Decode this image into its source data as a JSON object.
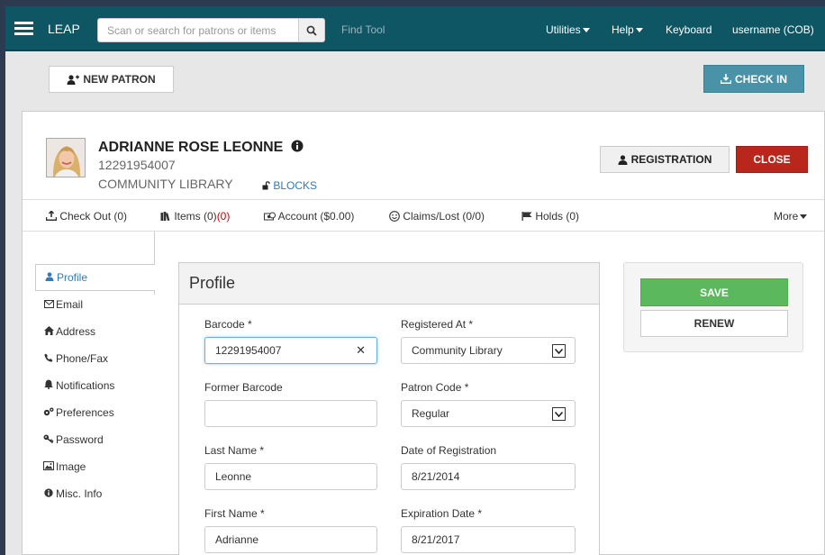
{
  "nav": {
    "brand": "LEAP",
    "search_placeholder": "Scan or search for patrons or items",
    "find_tool": "Find Tool",
    "utilities": "Utilities",
    "help": "Help",
    "keyboard": "Keyboard",
    "user": "username  (COB)"
  },
  "actions": {
    "new_patron": "NEW PATRON",
    "check_in": "CHECK IN"
  },
  "patron": {
    "name": "ADRIANNE ROSE LEONNE",
    "barcode": "12291954007",
    "library": "COMMUNITY LIBRARY",
    "blocks": "BLOCKS",
    "registration_btn": "REGISTRATION",
    "close_btn": "CLOSE"
  },
  "tabs": {
    "checkout": "Check Out (0)",
    "items": "Items (0)",
    "items_extra": "(0)",
    "account": "Account ($0.00)",
    "claims": "Claims/Lost (0/0)",
    "holds": "Holds (0)",
    "more": "More"
  },
  "sidebar": {
    "items": [
      {
        "label": "Profile",
        "icon": "user-icon"
      },
      {
        "label": "Email",
        "icon": "envelope-icon"
      },
      {
        "label": "Address",
        "icon": "home-icon"
      },
      {
        "label": "Phone/Fax",
        "icon": "phone-icon"
      },
      {
        "label": "Notifications",
        "icon": "bell-icon"
      },
      {
        "label": "Preferences",
        "icon": "gears-icon"
      },
      {
        "label": "Password",
        "icon": "key-icon"
      },
      {
        "label": "Image",
        "icon": "image-icon"
      },
      {
        "label": "Misc. Info",
        "icon": "info-icon"
      }
    ]
  },
  "profile": {
    "title": "Profile",
    "barcode_label": "Barcode *",
    "barcode_value": "12291954007",
    "registered_at_label": "Registered At *",
    "registered_at_value": "Community Library",
    "former_barcode_label": "Former Barcode",
    "former_barcode_value": "",
    "patron_code_label": "Patron Code *",
    "patron_code_value": "Regular",
    "last_name_label": "Last Name *",
    "last_name_value": "Leonne",
    "date_reg_label": "Date of Registration",
    "date_reg_value": "8/21/2014",
    "first_name_label": "First Name *",
    "first_name_value": "Adrianne",
    "exp_date_label": "Expiration Date *",
    "exp_date_value": "8/21/2017"
  },
  "side_actions": {
    "save": "SAVE",
    "renew": "RENEW"
  },
  "colors": {
    "topnav": "#0f5665",
    "checkin": "#4a92a8",
    "close": "#b8261c",
    "save": "#5cb85c",
    "link": "#337ab7"
  }
}
